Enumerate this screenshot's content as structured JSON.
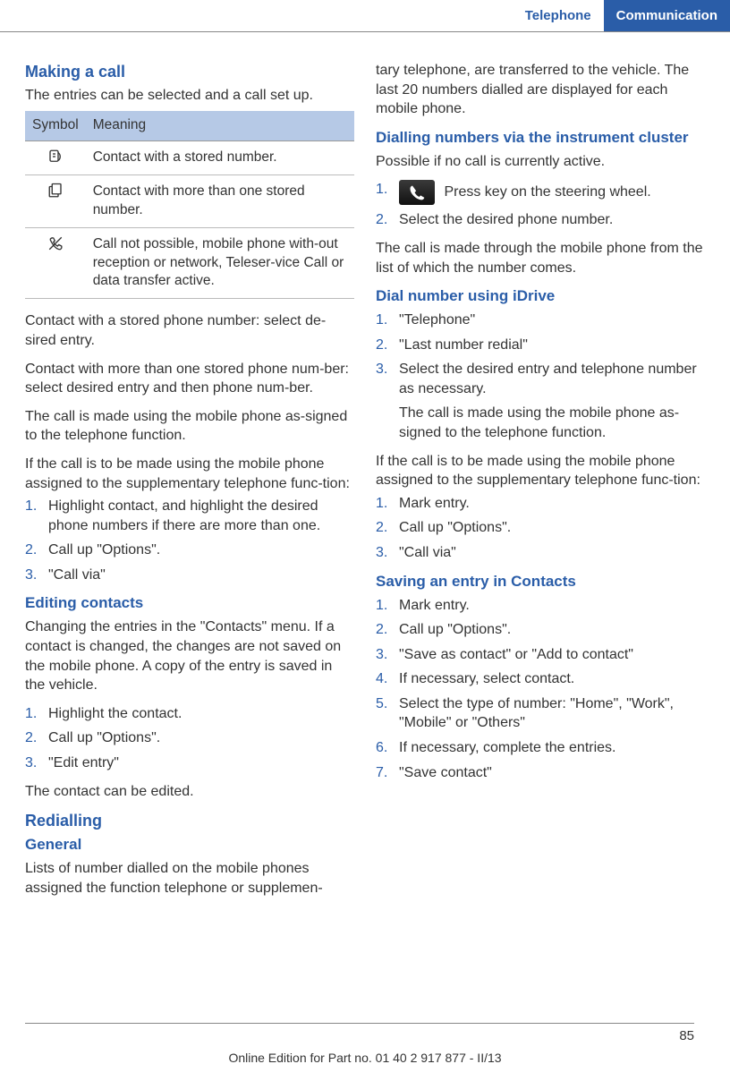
{
  "header": {
    "tab_plain": "Telephone",
    "tab_active": "Communication"
  },
  "left": {
    "h_making_call": "Making a call",
    "p_entries": "The entries can be selected and a call set up.",
    "table": {
      "th_symbol": "Symbol",
      "th_meaning": "Meaning",
      "r1": "Contact with a stored number.",
      "r2": "Contact with more than one stored number.",
      "r3": "Call not possible, mobile phone with‐out reception or network, Teleser‐vice Call or data transfer active."
    },
    "p_stored": "Contact with a stored phone number: select de‐sired entry.",
    "p_more": "Contact with more than one stored phone num‐ber: select desired entry and then phone num‐ber.",
    "p_made": "The call is made using the mobile phone as‐signed to the telephone function.",
    "p_supp": "If the call is to be made using the mobile phone assigned to the supplementary telephone func‐tion:",
    "list1": {
      "i1": "Highlight contact, and highlight the desired phone numbers if there are more than one.",
      "i2": "Call up \"Options\".",
      "i3": "\"Call via\""
    },
    "h_editing": "Editing contacts",
    "p_editing": "Changing the entries in the \"Contacts\" menu. If a contact is changed, the changes are not saved on the mobile phone. A copy of the entry is saved in the vehicle.",
    "list2": {
      "i1": "Highlight the contact.",
      "i2": "Call up \"Options\".",
      "i3": "\"Edit entry\""
    },
    "p_edited": "The contact can be edited.",
    "h_redialling": "Redialling",
    "h_general": "General",
    "p_general": "Lists of number dialled on the mobile phones assigned the function telephone or supplemen‐"
  },
  "right": {
    "p_cont": "tary telephone, are transferred to the vehicle. The last 20 numbers dialled are displayed for each mobile phone.",
    "h_cluster": "Dialling numbers via the instrument cluster",
    "p_cluster": "Possible if no call is currently active.",
    "list_cluster": {
      "i1": "Press key on the steering wheel.",
      "i2": "Select the desired phone number."
    },
    "p_cluster2": "The call is made through the mobile phone from the list of which the number comes.",
    "h_idrive": "Dial number using iDrive",
    "list_idrive": {
      "i1": "\"Telephone\"",
      "i2": "\"Last number redial\"",
      "i3": "Select the desired entry and telephone number as necessary.",
      "i3b": "The call is made using the mobile phone as‐signed to the telephone function."
    },
    "p_idrive2": "If the call is to be made using the mobile phone assigned to the supplementary telephone func‐tion:",
    "list_idrive2": {
      "i1": "Mark entry.",
      "i2": "Call up \"Options\".",
      "i3": "\"Call via\""
    },
    "h_save": "Saving an entry in Contacts",
    "list_save": {
      "i1": "Mark entry.",
      "i2": "Call up \"Options\".",
      "i3": "\"Save as contact\" or \"Add to contact\"",
      "i4": "If necessary, select contact.",
      "i5": "Select the type of number: \"Home\", \"Work\", \"Mobile\" or \"Others\"",
      "i6": "If necessary, complete the entries.",
      "i7": "\"Save contact\""
    }
  },
  "footer": {
    "pagenum": "85",
    "line": "Online Edition for Part no. 01 40 2 917 877 - II/13"
  }
}
